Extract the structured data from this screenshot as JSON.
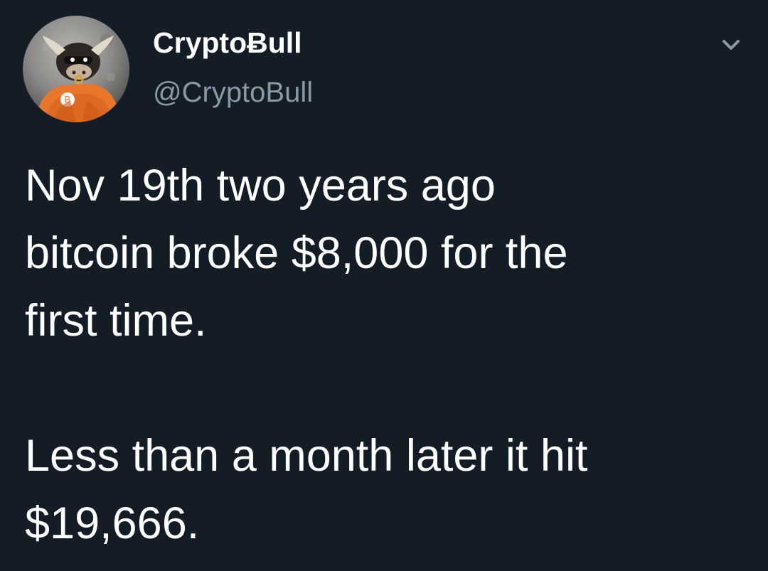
{
  "tweet": {
    "author": {
      "display_name": "CryptoɃull",
      "handle": "@CryptoBull",
      "avatar_icon": "bull-mascot-avatar-icon"
    },
    "menu_icon": "chevron-down-icon",
    "text": "Nov 19th two years ago\nbitcoin broke $8,000 for the\nfirst time.\n\nLess than a month later it hit\n$19,666."
  },
  "colors": {
    "background": "#141d26",
    "primary_text": "#ffffff",
    "secondary_text": "#8899a6",
    "avatar_orange": "#e8762b"
  }
}
